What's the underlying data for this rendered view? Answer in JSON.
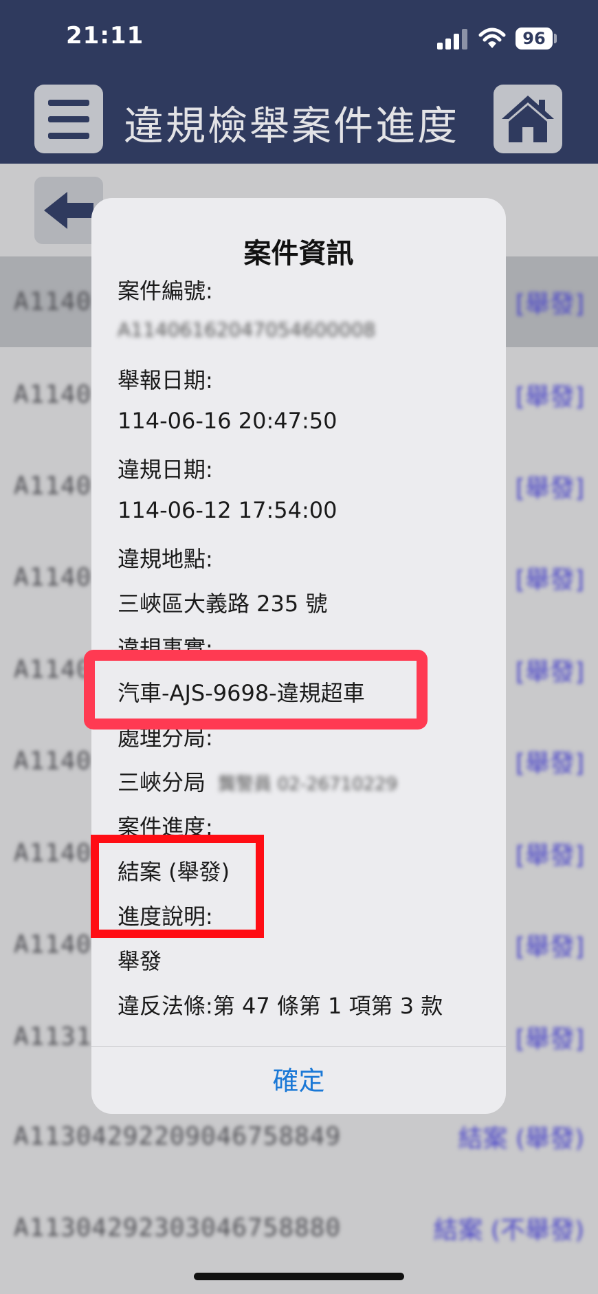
{
  "status_bar": {
    "time": "21:11",
    "battery": "96"
  },
  "header": {
    "title": "違規檢舉案件進度"
  },
  "list": {
    "rows": [
      {
        "number": "A1140",
        "status": "[舉發]"
      },
      {
        "number": "A1140",
        "status": "[舉發]"
      },
      {
        "number": "A1140",
        "status": "[舉發]"
      },
      {
        "number": "A1140",
        "status": "[舉發]"
      },
      {
        "number": "A1140",
        "status": "[舉發]"
      },
      {
        "number": "A1140",
        "status": "[舉發]"
      },
      {
        "number": "A1140",
        "status": "[舉發]"
      },
      {
        "number": "A1140",
        "status": "[舉發]"
      },
      {
        "number": "A1131",
        "status": "[舉發]"
      },
      {
        "number": "A11304292209046758849",
        "status": "結案 (舉發)"
      },
      {
        "number": "A11304292303046758880",
        "status": "結案 (不舉發)"
      }
    ]
  },
  "dialog": {
    "title": "案件資訊",
    "case_no_label": "案件編號:",
    "case_no_value": "A11406162047054600008",
    "report_date_label": "舉報日期:",
    "report_date_value": "114-06-16 20:47:50",
    "violation_date_label": "違規日期:",
    "violation_date_value": "114-06-12 17:54:00",
    "location_label": "違規地點:",
    "location_value": "三峽區大義路 235 號",
    "fact_label": "違規事實:",
    "fact_value": "汽車-AJS-9698-違規超車",
    "branch_label": "處理分局:",
    "branch_value": "三峽分局",
    "branch_contact": "龔警員 02-26710229",
    "progress_label": "案件進度:",
    "progress_value": "結案 (舉發)",
    "progress_note_label": "進度說明:",
    "progress_note_value": "舉發",
    "law_value": "違反法條:第 47 條第 1 項第 3 款",
    "confirm_label": "確定"
  },
  "colors": {
    "header_bg": "#2f3a5e",
    "confirm_text": "#1a78d6",
    "highlight_1": "#ff3a52",
    "highlight_2": "#ff0d14"
  }
}
